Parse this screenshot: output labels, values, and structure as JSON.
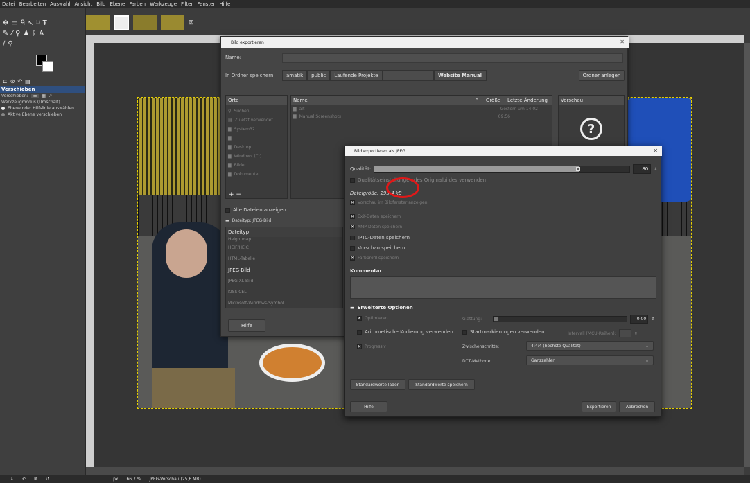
{
  "menubar": [
    "Datei",
    "Bearbeiten",
    "Auswahl",
    "Ansicht",
    "Bild",
    "Ebene",
    "Farben",
    "Werkzeuge",
    "Filter",
    "Fenster",
    "Hilfe"
  ],
  "toolbox": {
    "options_title": "Verschieben",
    "verschieben_label": "Verschieben:",
    "mode_label": "Werkzeugmodus (Umschalt)",
    "opt1": "Ebene oder Hilfslinie auswählen",
    "opt2": "Aktive Ebene verschieben"
  },
  "statusbar": {
    "unit": "px",
    "zoom": "66,7 %",
    "info": "JPEG-Vorschau (25,6 MB)"
  },
  "export_dialog": {
    "title": "Bild exportieren",
    "name_label": "Name:",
    "folder_label": "In Ordner speichern:",
    "crumbs": [
      "amatik",
      "public",
      "Laufende Projekte",
      "",
      "Website Manual"
    ],
    "create_folder": "Ordner anlegen",
    "places_header": "Orte",
    "places": [
      "Suchen",
      "Zuletzt verwendet",
      "System32",
      "",
      "Desktop",
      "Windows (C:)",
      "Bilder",
      "Dokumente"
    ],
    "files_header": {
      "name": "Name",
      "size": "Größe",
      "modified": "Letzte Änderung"
    },
    "files": [
      {
        "name": "alt",
        "modified": "Gestern um 14:02"
      },
      {
        "name": "Manual Screenshots",
        "modified": "09:56"
      }
    ],
    "preview_header": "Vorschau",
    "show_all": "Alle Dateien anzeigen",
    "filetype_toggle": "Dateityp: JPEG-Bild",
    "filetype_header": "Dateityp",
    "filetypes": [
      "Heightmap",
      "HEIF/HEIC",
      "HTML-Tabelle",
      "JPEG-Bild",
      "JPEG-XL-Bild",
      "KISS CEL",
      "Microsoft-Windows-Symbol"
    ],
    "help": "Hilfe"
  },
  "jpeg_dialog": {
    "title": "Bild exportieren als JPEG",
    "quality_label": "Qualität:",
    "quality_value": 80,
    "use_orig_quality": "Qualitätseinstellungen des Originalbildes verwenden",
    "filesize": "Dateigröße: 293,4 kB",
    "show_preview": "Vorschau im Bildfenster anzeigen",
    "save_exif": "Exif-Daten speichern",
    "save_xmp": "XMP-Daten speichern",
    "save_iptc": "IPTC-Daten speichern",
    "save_thumb": "Vorschau speichern",
    "save_profile": "Farbprofil speichern",
    "comment_label": "Kommentar",
    "advanced": "Erweiterte Optionen",
    "optimize": "Optimieren",
    "smoothing_label": "Glättung:",
    "smoothing_value": "0,00",
    "arithmetic": "Arithmetische Kodierung verwenden",
    "restart": "Startmarkierungen verwenden",
    "interval": "Intervall (MCU-Reihen):",
    "progressive": "Progressiv",
    "subsampling_label": "Zwischenschritte:",
    "subsampling": "4:4:4 (höchste Qualität)",
    "dct_label": "DCT-Methode:",
    "dct": "Ganzzahlen",
    "load_defaults": "Standardwerte laden",
    "save_defaults": "Standardwerte speichern",
    "help": "Hilfe",
    "export": "Exportieren",
    "cancel": "Abbrechen",
    "checked": {
      "exif": true,
      "xmp": true,
      "iptc": false,
      "thumb": false,
      "profile": true,
      "optimize": true,
      "arith": false,
      "restart": false,
      "progressive": true,
      "preview": true,
      "orig": false
    }
  },
  "colors": {
    "annotation": "#e01818",
    "selection": "#e6d000"
  }
}
